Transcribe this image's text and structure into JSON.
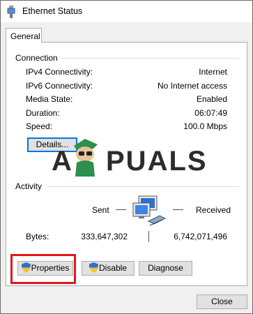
{
  "window": {
    "title": "Ethernet Status"
  },
  "tabs": [
    {
      "label": "General"
    }
  ],
  "connection": {
    "heading": "Connection",
    "rows": [
      {
        "label": "IPv4 Connectivity:",
        "value": "Internet"
      },
      {
        "label": "IPv6 Connectivity:",
        "value": "No Internet access"
      },
      {
        "label": "Media State:",
        "value": "Enabled"
      },
      {
        "label": "Duration:",
        "value": "06:07:49"
      },
      {
        "label": "Speed:",
        "value": "100.0 Mbps"
      }
    ],
    "details_label": "Details..."
  },
  "activity": {
    "heading": "Activity",
    "sent_label": "Sent",
    "received_label": "Received",
    "bytes_label": "Bytes:",
    "bytes_sent": "333,647,302",
    "bytes_received": "6,742,071,496"
  },
  "actions": {
    "properties_label": "Properties",
    "disable_label": "Disable",
    "diagnose_label": "Diagnose"
  },
  "footer": {
    "close_label": "Close"
  },
  "watermark": {
    "text_left": "A",
    "text_right": "PUALS"
  },
  "colors": {
    "highlight": "#e0161e",
    "focus": "#0078d7",
    "panel_bg": "#ffffff",
    "window_bg": "#f0f0f0"
  },
  "icons": {
    "title": "ethernet-plug-icon",
    "shield": "uac-shield-icon",
    "network": "network-computers-icon"
  }
}
